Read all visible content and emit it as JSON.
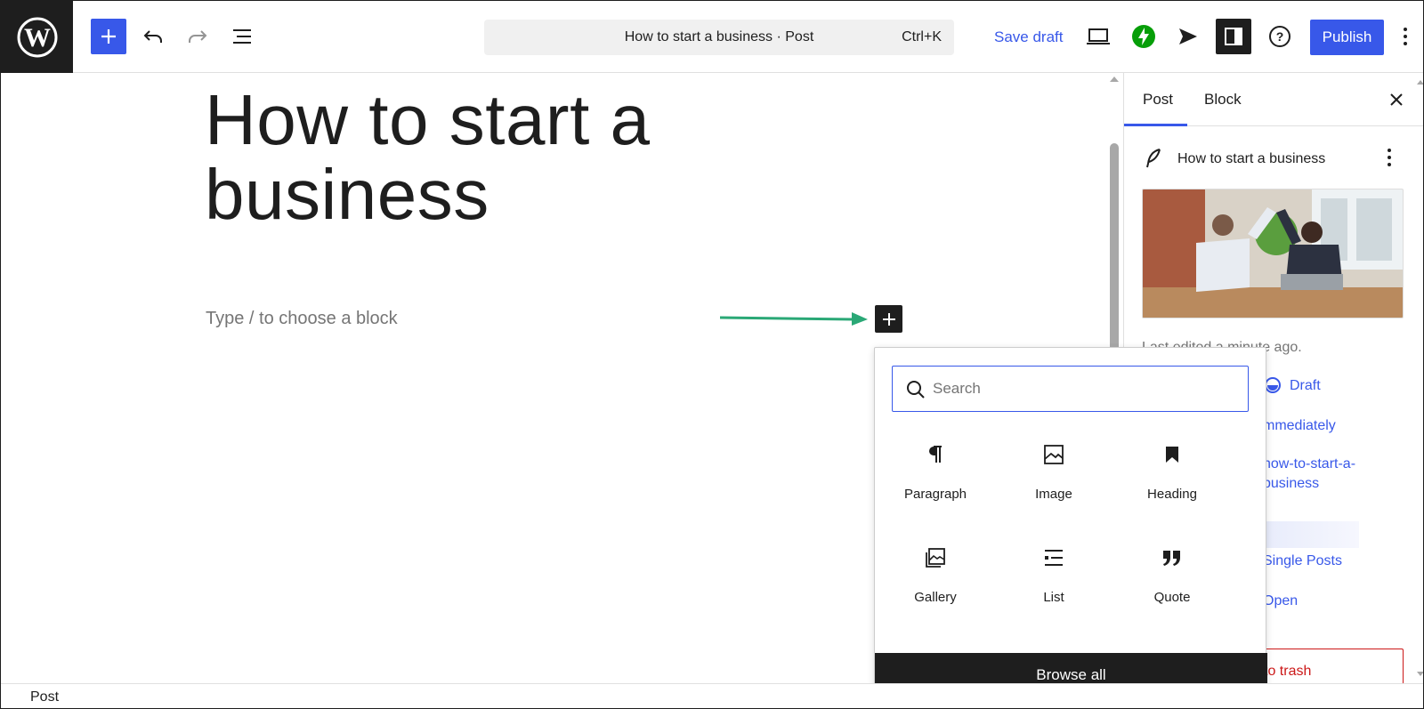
{
  "topbar": {
    "command_title": "How to start a business · Post",
    "command_shortcut": "Ctrl+K",
    "save_draft_label": "Save draft",
    "publish_label": "Publish",
    "icons": [
      "wordpress-logo-icon",
      "plus-icon",
      "undo-icon",
      "redo-icon",
      "list-view-icon",
      "preview-device-icon",
      "jetpack-icon",
      "send-icon",
      "sidebar-toggle-icon",
      "help-icon",
      "more-vertical-icon"
    ]
  },
  "editor": {
    "title": "How to start a business",
    "placeholder": "Type / to choose a block"
  },
  "sidebar": {
    "tabs": [
      {
        "label": "Post"
      },
      {
        "label": "Block"
      }
    ],
    "post_title": "How to start a business",
    "last_edited": "Last edited a minute ago.",
    "status": "Draft",
    "publish": "mmediately",
    "slug_line1": "how-to-start-a-",
    "slug_line2": "business",
    "template": "Single Posts",
    "comments": "Open",
    "trash": "to trash"
  },
  "inserter": {
    "search_placeholder": "Search",
    "blocks": [
      {
        "label": "Paragraph",
        "icon": "paragraph-icon"
      },
      {
        "label": "Image",
        "icon": "image-icon"
      },
      {
        "label": "Heading",
        "icon": "heading-icon"
      },
      {
        "label": "Gallery",
        "icon": "gallery-icon"
      },
      {
        "label": "List",
        "icon": "list-icon"
      },
      {
        "label": "Quote",
        "icon": "quote-icon"
      }
    ],
    "browse_all_label": "Browse all"
  },
  "footer": {
    "breadcrumb": "Post"
  },
  "colors": {
    "accent": "#3858e9",
    "dark": "#1e1e1e",
    "arrow": "#2aa876",
    "jetpack": "#069e08",
    "danger": "#cc1818"
  }
}
